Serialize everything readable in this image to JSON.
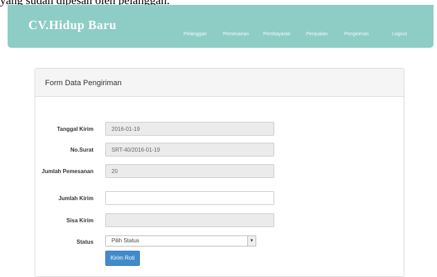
{
  "page_caption": "yang sudah dipesan oleh pelanggan.",
  "navbar": {
    "brand": "CV.Hidup Baru",
    "links": [
      "Pelanggan",
      "Pemesanan",
      "Pembayaran",
      "Penjualan",
      "Pengiriman",
      "Logout"
    ]
  },
  "panel": {
    "title": "Form Data Pengiriman"
  },
  "form": {
    "tanggal_kirim": {
      "label": "Tanggal Kirim",
      "value": "2016-01-19"
    },
    "no_surat": {
      "label": "No.Surat",
      "value": "SRT-40/2016-01-19"
    },
    "jumlah_pemesanan": {
      "label": "Jumlah Pemesanan",
      "value": "20"
    },
    "jumlah_kirim": {
      "label": "Jumlah Kirim",
      "value": ""
    },
    "sisa_kirim": {
      "label": "Sisa Kirim",
      "value": ""
    },
    "status": {
      "label": "Status",
      "selected": "Pilih Status"
    },
    "submit_label": "Kirim Roti"
  },
  "colors": {
    "navbar": "#8ecdc6",
    "button": "#428bca"
  }
}
